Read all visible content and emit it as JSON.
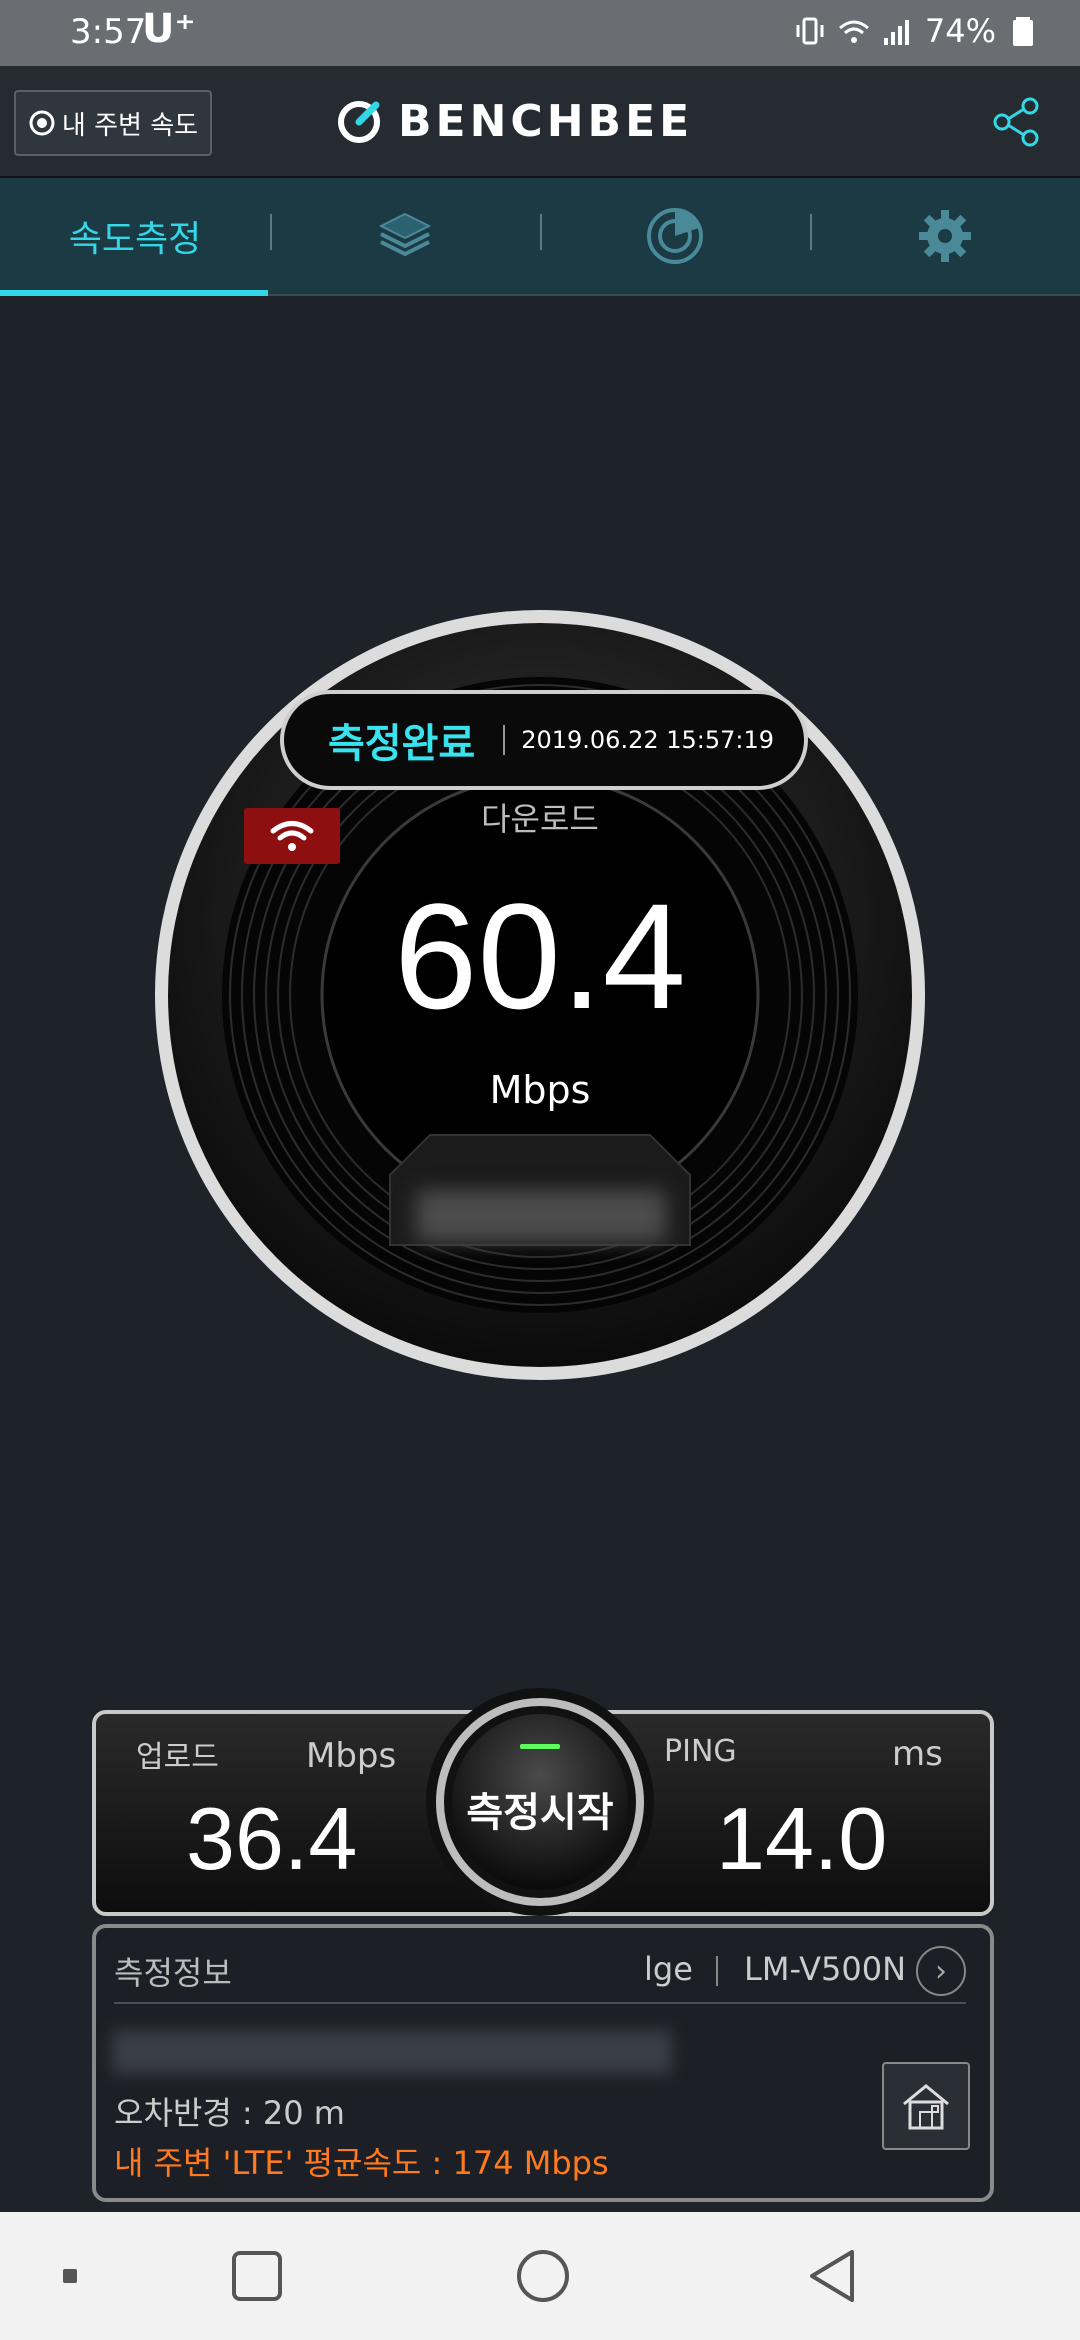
{
  "status_bar": {
    "time": "3:57",
    "carrier": "U⁺",
    "battery": "74%"
  },
  "header": {
    "nearby_label": "내 주변 속도",
    "logo": "BENCHBEE"
  },
  "tabs": [
    {
      "label": "속도측정",
      "icon": "speed-tab",
      "active": true
    },
    {
      "label": "",
      "icon": "layers-icon"
    },
    {
      "label": "",
      "icon": "chart-icon"
    },
    {
      "label": "",
      "icon": "gear-icon"
    }
  ],
  "gauge": {
    "status": "측정완료",
    "datetime": "2019.06.22 15:57:19",
    "download_label": "다운로드",
    "download_value": "60.4",
    "unit": "Mbps",
    "network_icon": "wifi-icon"
  },
  "results": {
    "upload_label": "업로드",
    "upload_unit": "Mbps",
    "upload_value": "36.4",
    "start_label": "측정시작",
    "ping_label": "PING",
    "ping_unit": "ms",
    "ping_value": "14.0"
  },
  "info": {
    "title": "측정정보",
    "brand": "lge",
    "model": "LM-V500N",
    "error_radius": "오차반경 : 20 m",
    "avg_speed": "내 주변 'LTE' 평균속도 :  174 Mbps"
  },
  "colors": {
    "accent": "#33d7e6",
    "orange": "#ff7a1f",
    "badge": "#8d0f0f"
  }
}
